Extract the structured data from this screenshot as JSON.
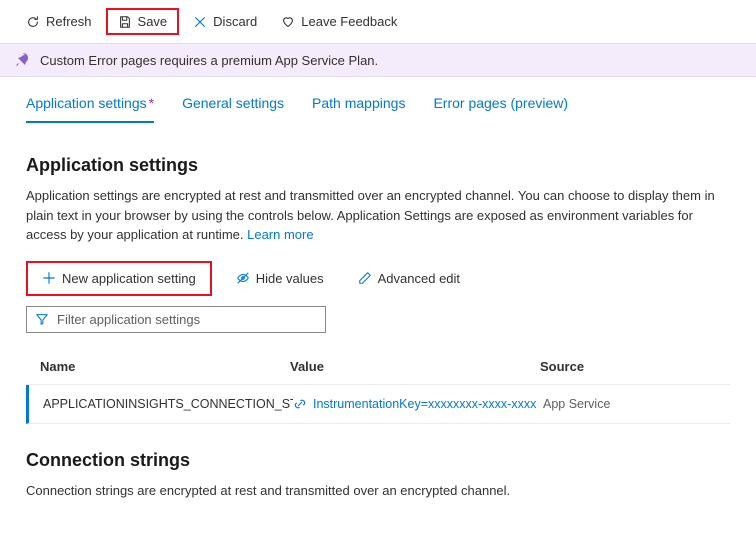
{
  "toolbar": {
    "refresh": "Refresh",
    "save": "Save",
    "discard": "Discard",
    "feedback": "Leave Feedback"
  },
  "banner": {
    "text": "Custom Error pages requires a premium App Service Plan."
  },
  "tabs": {
    "appsettings": "Application settings",
    "general": "General settings",
    "path": "Path mappings",
    "error": "Error pages (preview)"
  },
  "section_appsettings": {
    "title": "Application settings",
    "desc": "Application settings are encrypted at rest and transmitted over an encrypted channel. You can choose to display them in plain text in your browser by using the controls below. Application Settings are exposed as environment variables for access by your application at runtime. ",
    "learn_more": "Learn more"
  },
  "actions": {
    "new_setting": "New application setting",
    "hide_values": "Hide values",
    "advanced_edit": "Advanced edit"
  },
  "filter": {
    "placeholder": "Filter application settings"
  },
  "table": {
    "head_name": "Name",
    "head_value": "Value",
    "head_source": "Source",
    "rows": [
      {
        "name": "APPLICATIONINSIGHTS_CONNECTION_STRING",
        "value": "InstrumentationKey=xxxxxxxx-xxxx-xxxx",
        "source": "App Service"
      }
    ]
  },
  "section_conn": {
    "title": "Connection strings",
    "desc": "Connection strings are encrypted at rest and transmitted over an encrypted channel."
  }
}
